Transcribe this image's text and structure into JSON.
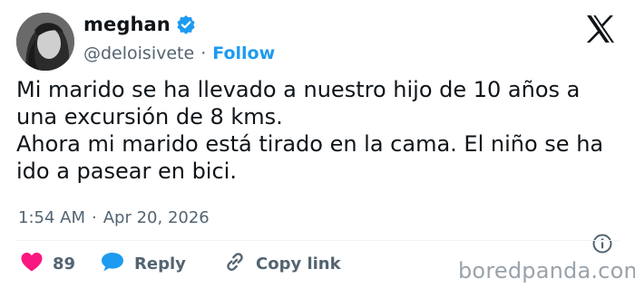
{
  "tweet": {
    "display_name": "meghan",
    "handle": "@deloisivete",
    "separator": "·",
    "follow_label": "Follow",
    "text_lines": [
      "Mi marido se ha llevado a nuestro hijo de 10 años a",
      "una excursión de 8 kms.",
      "Ahora mi marido está tirado en la cama. El niño se ha",
      "ido a pasear en bici."
    ],
    "time": "1:54 AM",
    "date": "Apr 20, 2026",
    "actions": {
      "like_count": "89",
      "reply_label": "Reply",
      "copy_label": "Copy link"
    }
  },
  "icons": {
    "verified": "verified-badge-icon",
    "platform": "x-logo-icon",
    "info": "info-icon",
    "like": "heart-icon",
    "reply": "speech-bubble-icon",
    "copy": "link-icon"
  },
  "colors": {
    "accent": "#1d9bf0",
    "like": "#f91880",
    "secondary_text": "#536471",
    "primary_text": "#0f1419"
  },
  "watermark": "boredpanda.com"
}
